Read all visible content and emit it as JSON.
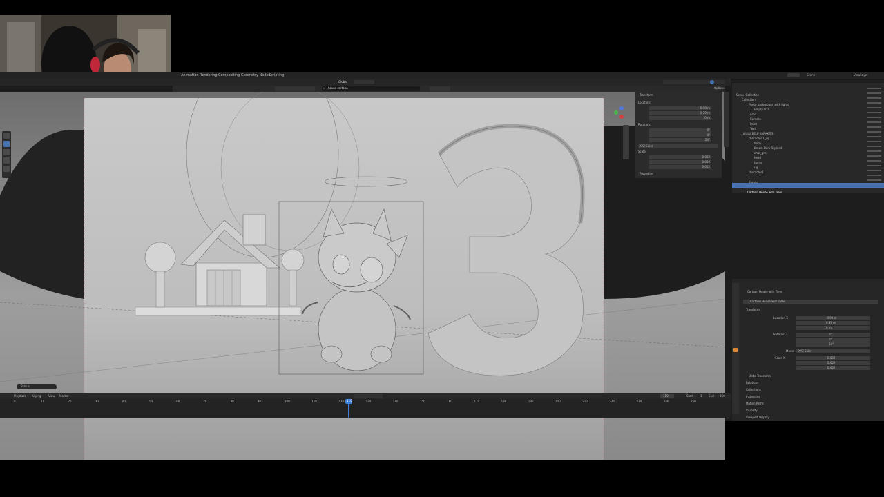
{
  "workspace_tabs": [
    "Animation",
    "Rendering",
    "Compositing",
    "Geometry Nodes",
    "Scripting"
  ],
  "viewport": {
    "shading_mode": "Global",
    "search_text": "house cartoon",
    "options_label": "Options",
    "status_label": "Status"
  },
  "npanel": {
    "section": "Transform",
    "location_label": "Location:",
    "location": [
      "0.98 m",
      "0.39 m",
      "0 m"
    ],
    "rotation_label": "Rotation:",
    "rotation": [
      "0°",
      "0°",
      "24°"
    ],
    "rotation_mode": "XYZ Euler",
    "scale_label": "Scale:",
    "scale": [
      "0.002",
      "0.002",
      "0.002"
    ],
    "properties_label": "Properties"
  },
  "outliner": {
    "scene_label": "Scene",
    "viewlayer_label": "ViewLayer",
    "items": [
      "Scene Collection",
      "Collection",
      "Photo background with lights",
      "Empty.002",
      "Area",
      "Camera",
      "Point",
      "Text",
      "LIULU BELE KARAKTER",
      "character 1_rig",
      "Body",
      "Brown Dark Stylized",
      "char_grp",
      "head",
      "horns",
      "rig",
      "character1",
      "Empty",
      "Cartoon House with Trees",
      "Cartoon House with Trees"
    ]
  },
  "properties": {
    "object_name": "Cartoon House with Trees",
    "object_subname": "Cartoon House with Trees",
    "transform_label": "Transform",
    "location_label": "Location X",
    "location": [
      "-0.98 m",
      "0.39 m",
      "0 m"
    ],
    "rotation_label": "Rotation X",
    "rotation": [
      "0°",
      "0°",
      "24°"
    ],
    "mode_label": "Mode",
    "mode_value": "XYZ Euler",
    "scale_label": "Scale X",
    "scale": [
      "0.002",
      "0.002",
      "0.002"
    ],
    "sections": [
      "Delta Transform",
      "Relations",
      "Collections",
      "Instancing",
      "Motion Paths",
      "Visibility",
      "Viewport Display"
    ]
  },
  "timeline": {
    "menus": [
      "Playback",
      "Keying",
      "View",
      "Marker"
    ],
    "current_frame": "110",
    "start_label": "Start",
    "start_value": "1",
    "end_label": "End",
    "end_value": "250",
    "ticks": [
      "0",
      "10",
      "20",
      "30",
      "40",
      "50",
      "60",
      "70",
      "80",
      "90",
      "100",
      "110",
      "120",
      "130",
      "140",
      "150",
      "160",
      "170",
      "180",
      "190",
      "200",
      "210",
      "220",
      "230",
      "240",
      "250"
    ]
  },
  "colors": {
    "accent": "#4772b3",
    "playhead": "#3d7fd6",
    "background": "#1d1d1d"
  }
}
